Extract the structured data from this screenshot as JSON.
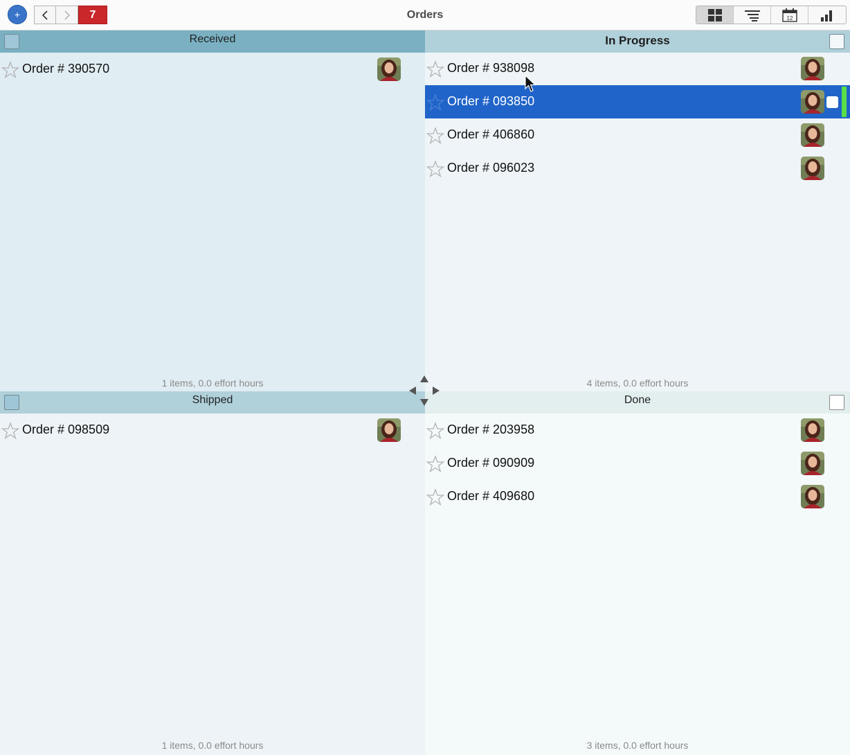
{
  "toolbar": {
    "add_label": "+",
    "badge_count": "7",
    "title": "Orders"
  },
  "quadrants": {
    "received": {
      "title": "Received",
      "footer": "1 items, 0.0 effort hours",
      "orders": [
        "Order # 390570"
      ]
    },
    "in_progress": {
      "title": "In Progress",
      "footer": "4 items, 0.0 effort hours",
      "orders": [
        "Order # 938098",
        "Order # 093850",
        "Order # 406860",
        "Order # 096023"
      ],
      "selected_index": 1
    },
    "shipped": {
      "title": "Shipped",
      "footer": "1 items, 0.0 effort hours",
      "orders": [
        "Order # 098509"
      ]
    },
    "done": {
      "title": "Done",
      "footer": "3 items, 0.0 effort hours",
      "orders": [
        "Order # 203958",
        "Order # 090909",
        "Order # 409680"
      ]
    }
  },
  "colors": {
    "selection": "#2064c9",
    "badge": "#c9272a",
    "status_bar": "#58e048"
  },
  "icons": [
    "back-icon",
    "forward-icon",
    "grid-view-icon",
    "outline-view-icon",
    "calendar-view-icon",
    "chart-view-icon",
    "star-icon",
    "avatar",
    "move-arrows-icon"
  ]
}
